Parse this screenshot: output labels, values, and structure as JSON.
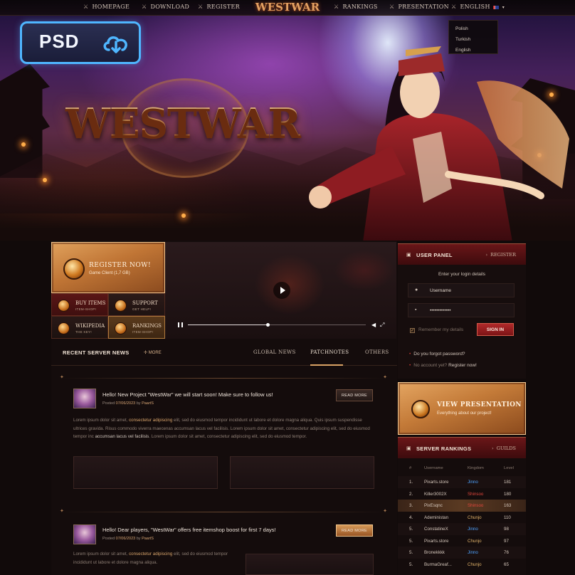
{
  "nav": {
    "items": [
      {
        "label": "HOMEPAGE",
        "icon": "sword-icon"
      },
      {
        "label": "DOWNLOAD",
        "icon": "sword-icon"
      },
      {
        "label": "REGISTER",
        "icon": "user-icon"
      },
      {
        "label": "RANKINGS",
        "icon": "trophy-icon"
      },
      {
        "label": "PRESENTATION",
        "icon": "sword-icon"
      }
    ],
    "logo": "WESTWAR",
    "language": "ENGLISH",
    "language_options": [
      "Polish",
      "Turkish",
      "English"
    ]
  },
  "badge": {
    "label": "PSD"
  },
  "hero": {
    "logo": "WESTWAR"
  },
  "register": {
    "title": "REGISTER NOW!",
    "subtitle": "Game Client (1,7 GB)"
  },
  "quick_links": [
    {
      "label": "BUY ITEMS",
      "sub": "ITEM-SHOP!"
    },
    {
      "label": "SUPPORT",
      "sub": "GET HELP!"
    },
    {
      "label": "WIKIPEDIA",
      "sub": "THE KEY!"
    },
    {
      "label": "RANKINGS",
      "sub": "ITEM-SHOP!"
    }
  ],
  "video": {
    "progress": 0.44
  },
  "news": {
    "title": "RECENT SERVER NEWS",
    "more": "MORE",
    "tabs": [
      "GLOBAL NEWS",
      "PATCHNOTES",
      "OTHERS"
    ],
    "active_tab": "PATCHNOTES",
    "posts": [
      {
        "title": "Hello! New Project \"WestWar\" we will start soon! Make sure to follow us!",
        "posted": "Posted",
        "date": "07/06/2023",
        "by": "by",
        "author": "PaartS",
        "read_more": "READ MORE",
        "body_1": "Lorem ipsum dolor sit amet, ",
        "body_hl1": "consectetur adipiscing",
        "body_2": " elit, sed do eiusmod tempor incididunt ut labore et dolore magna aliqua. Quis ipsum suspendisse ultrices gravida. Risus commodo viverra maecenas accumsan lacus vel facilisis. Lorem ipsum dolor sit amet, consectetur adipiscing elit, sed do eiusmod tempor inc ",
        "body_hl2": "accumsan lacus vel facilisis",
        "body_3": ". Lorem ipsum dolor sit amet, consectetur adipiscing elit, sed do eiusmod tempor."
      },
      {
        "title": "Hello! Dear players, \"WestWar\" offers free itemshop boost for first 7 days!",
        "posted": "Posted",
        "date": "07/06/2023",
        "by": "by",
        "author": "PaartS",
        "read_more": "READ MORE",
        "body_1": "Lorem ipsum dolor sit amet, ",
        "body_hl1": "consectetur adipiscing",
        "body_2": " elit, sed do eiusmod tempor incididunt ut labore et dolore magna aliqua."
      }
    ]
  },
  "user_panel": {
    "title": "USER PANEL",
    "register": "REGISTER",
    "prompt": "Enter your login details",
    "username_placeholder": "Username",
    "password_value": "•••••••••••••",
    "remember": "Remember my details",
    "sign_in": "SIGN IN",
    "forgot": "Do you forgot password?",
    "no_account": "No account yet?",
    "register_now": "Register now!"
  },
  "presentation": {
    "title": "VIEW PRESENTATION",
    "subtitle": "Everything about our project!"
  },
  "rankings": {
    "title": "SERVER RANKINGS",
    "tab": "GUILDS",
    "headers": [
      "#",
      "Username",
      "Kingdom",
      "Level"
    ],
    "rows": [
      {
        "rank": "1.",
        "name": "Pixarts.store",
        "kingdom": "Jinno",
        "level": "181",
        "kc": "blue"
      },
      {
        "rank": "2.",
        "name": "Killer3002X",
        "kingdom": "Shinsoo",
        "level": "180",
        "kc": "red"
      },
      {
        "rank": "3.",
        "name": "PixEsqnc",
        "kingdom": "Shinsoo",
        "level": "163",
        "kc": "red"
      },
      {
        "rank": "4.",
        "name": "Adeministan",
        "kingdom": "Chunjo",
        "level": "110",
        "kc": "gold"
      },
      {
        "rank": "5.",
        "name": "ConstatineX",
        "kingdom": "Jinno",
        "level": "98",
        "kc": "blue"
      },
      {
        "rank": "5.",
        "name": "Pixarts.store",
        "kingdom": "Chunjo",
        "level": "97",
        "kc": "gold"
      },
      {
        "rank": "5.",
        "name": "Bronekkkk",
        "kingdom": "Jinno",
        "level": "76",
        "kc": "blue"
      },
      {
        "rank": "5.",
        "name": "BurmaGreaf...",
        "kingdom": "Chunjo",
        "level": "65",
        "kc": "gold"
      }
    ]
  },
  "colors": {
    "accent_gold": "#d9a265",
    "accent_red": "#6a1618",
    "kingdom_jinno": "#4ea3ff",
    "kingdom_shinsoo": "#e0463c",
    "kingdom_chunjo": "#e0b26a"
  }
}
